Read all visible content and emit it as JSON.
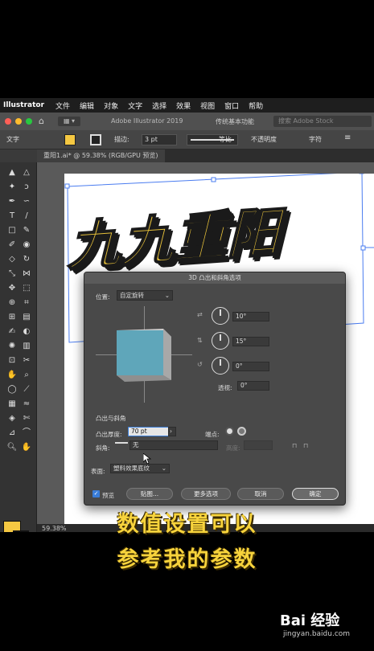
{
  "app": {
    "name": "Illustrator",
    "menu": [
      "文件",
      "编辑",
      "对象",
      "文字",
      "选择",
      "效果",
      "视图",
      "窗口",
      "帮助"
    ]
  },
  "titlebar": {
    "title": "Adobe Illustrator 2019",
    "workspace": "传统基本功能",
    "search_placeholder": "搜索 Adobe Stock"
  },
  "control_bar": {
    "mode_label": "文字",
    "stroke_label": "描边:",
    "stroke_value": "3 pt",
    "profile_label": "等比",
    "opacity_label": "不透明度",
    "char_label": "字符"
  },
  "document_tab": "重阳1.ai* @ 59.38% (RGB/GPU 预览)",
  "artwork": {
    "title_text": "九九重阳",
    "fill_color": "#e8c23a",
    "shadow_color": "#1a1a1a"
  },
  "statusbar": {
    "zoom": "59.38%"
  },
  "dialog": {
    "title": "3D 凸出和斜角选项",
    "position_label": "位置:",
    "position_value": "自定旋转",
    "rotation_x": "10°",
    "rotation_y": "15°",
    "rotation_z": "0°",
    "perspective_label": "透视:",
    "perspective_value": "0°",
    "extrude_section": "凸出与斜角",
    "extrude_depth_label": "凸出厚度:",
    "extrude_depth_value": "70 pt",
    "cap_label": "端点:",
    "bevel_label": "斜角:",
    "bevel_value": "无",
    "height_label": "高度:",
    "surface_label": "表面:",
    "surface_value": "塑料效果底纹",
    "preview_label": "预览",
    "map_button": "贴图...",
    "more_options_button": "更多选项",
    "cancel_button": "取消",
    "ok_button": "确定",
    "cube_front_color": "#5fa6ba",
    "cube_side_color": "#a8a8a8"
  },
  "subtitle": {
    "line1": "数值设置可以",
    "line2": "参考我的参数",
    "color": "#f7d33c"
  },
  "watermark": {
    "logo": "Bai 经验",
    "url": "jingyan.baidu.com"
  }
}
